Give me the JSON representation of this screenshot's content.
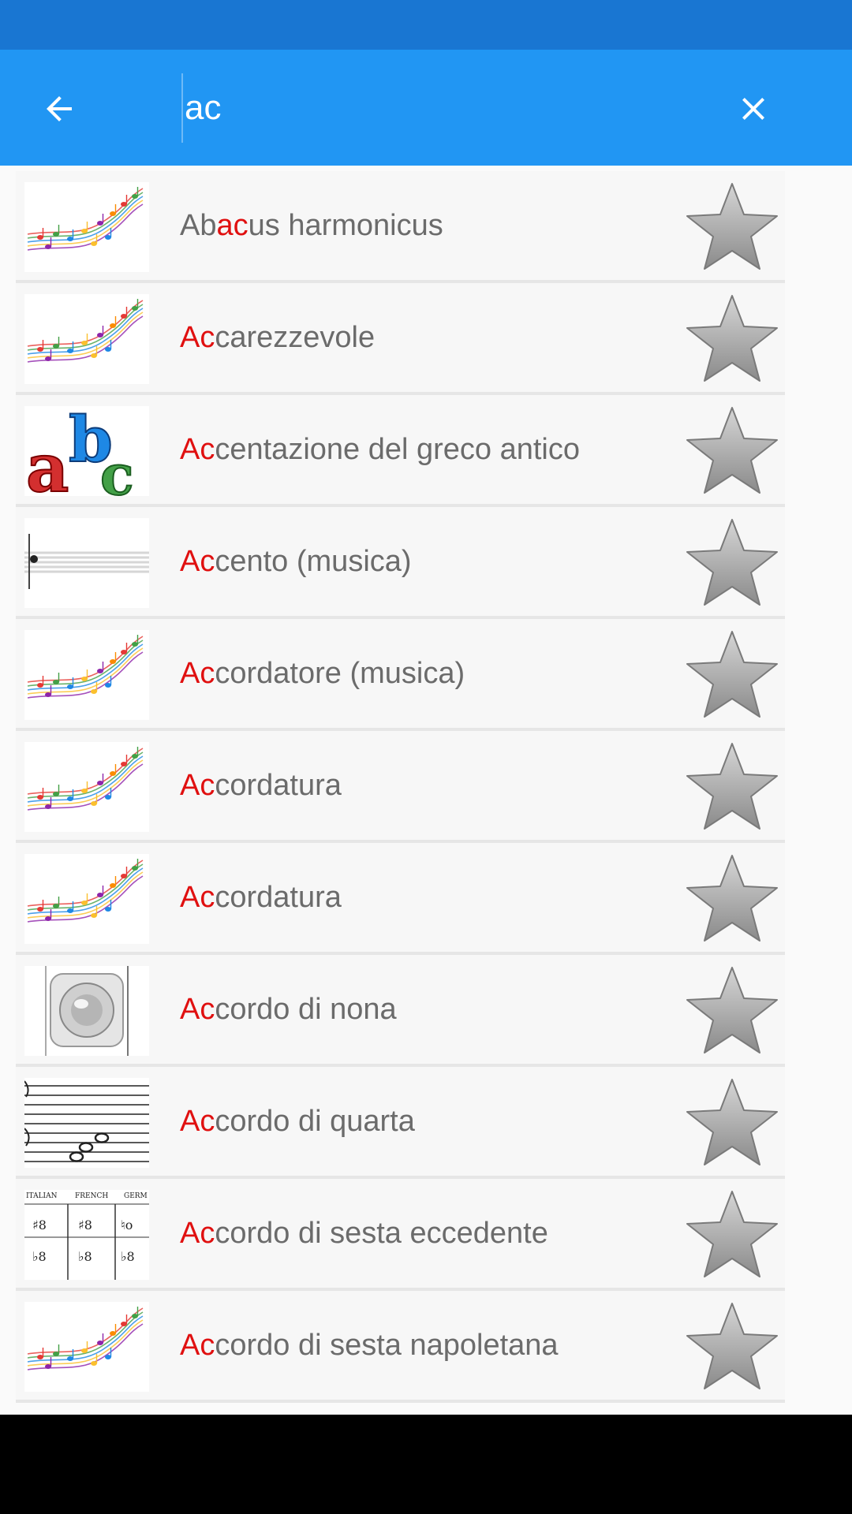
{
  "search": {
    "query": "ac"
  },
  "colors": {
    "status_bar": "#1976d2",
    "app_bar": "#2196f3",
    "highlight": "#e01010",
    "text": "#6b6b6b"
  },
  "icons": {
    "back": "arrow-back-icon",
    "clear": "close-icon",
    "favorite": "star-icon"
  },
  "results": [
    {
      "pre": "Ab",
      "match": "ac",
      "post": "us harmonicus",
      "thumb": "music-notes-icon"
    },
    {
      "pre": "",
      "match": "Ac",
      "post": "carezzevole",
      "thumb": "music-notes-icon"
    },
    {
      "pre": "",
      "match": "Ac",
      "post": "centazione del greco antico",
      "thumb": "abc-letters-icon"
    },
    {
      "pre": "",
      "match": "Ac",
      "post": "cento (musica)",
      "thumb": "staff-icon"
    },
    {
      "pre": "",
      "match": "Ac",
      "post": "cordatore (musica)",
      "thumb": "music-notes-icon"
    },
    {
      "pre": "",
      "match": "Ac",
      "post": "cordatura",
      "thumb": "music-notes-icon"
    },
    {
      "pre": "",
      "match": "Ac",
      "post": "cordatura",
      "thumb": "music-notes-icon"
    },
    {
      "pre": "",
      "match": "Ac",
      "post": "cordo di nona",
      "thumb": "speaker-icon"
    },
    {
      "pre": "",
      "match": "Ac",
      "post": "cordo di quarta",
      "thumb": "chord-notation-icon"
    },
    {
      "pre": "",
      "match": "Ac",
      "post": "cordo di sesta eccedente",
      "thumb": "sheet-table-icon",
      "thumb_text": {
        "h1": "ITALIAN",
        "h2": "FRENCH",
        "h3": "GERM"
      }
    },
    {
      "pre": "",
      "match": "Ac",
      "post": "cordo di sesta napoletana",
      "thumb": "music-notes-icon"
    }
  ]
}
